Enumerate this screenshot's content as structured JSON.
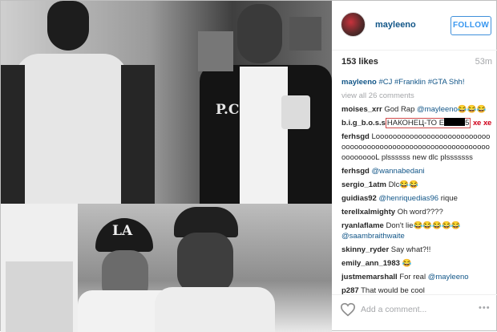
{
  "post": {
    "username": "mayleeno",
    "follow_label": "FOLLOW",
    "likes": "153 likes",
    "time_ago": "53m",
    "caption_user": "mayleeno",
    "caption_text": "#CJ #Franklin #GTA Shh!",
    "view_all": "view all 26 comments"
  },
  "comments": [
    {
      "user": "moises_xrr",
      "text": "God Rap",
      "mention": "@mayleeno",
      "emoji": "😂😂😂"
    },
    {
      "user": "b.i.g_b.o.s.s",
      "boxed_text": "НАКОНЕЦ-ТО Е",
      "boxed_tail": "5",
      "suffix": "хе хе"
    },
    {
      "user": "ferhsgd",
      "text": "LooooooooooooooooooooooooooooooooooooooooooooooooooooooooooooooooooooooL plssssss new dlc plsssssss"
    },
    {
      "user": "ferhsgd",
      "mention": "@wannabedani"
    },
    {
      "user": "sergio_1atm",
      "text": "Dlc😂😂"
    },
    {
      "user": "guidias92",
      "mention": "@henriquedias96",
      "text": "rique"
    },
    {
      "user": "terellxalmighty",
      "text": "Oh word????"
    },
    {
      "user": "ryanlaflame",
      "text": "Don't lie😂😂😂😂😂",
      "mention": "@saambraithwaite"
    },
    {
      "user": "skinny_ryder",
      "text": "Say what?!!"
    },
    {
      "user": "emily_ann_1983",
      "emoji": "😂"
    },
    {
      "user": "justmemarshall",
      "text": "For real",
      "mention": "@mayleeno"
    },
    {
      "user": "p287",
      "text": "That would be cool"
    }
  ],
  "footer": {
    "add_comment_placeholder": "Add a comment...",
    "more_label": "•••"
  },
  "photo": {
    "jacket_text": "P.C",
    "cap_text": "LA"
  },
  "icons": {
    "heart": "heart-icon",
    "more": "more-options-icon"
  },
  "colors": {
    "link": "#125688",
    "follow_blue": "#3897f0",
    "muted": "#a5a7aa",
    "highlight_red": "#d0021b"
  }
}
